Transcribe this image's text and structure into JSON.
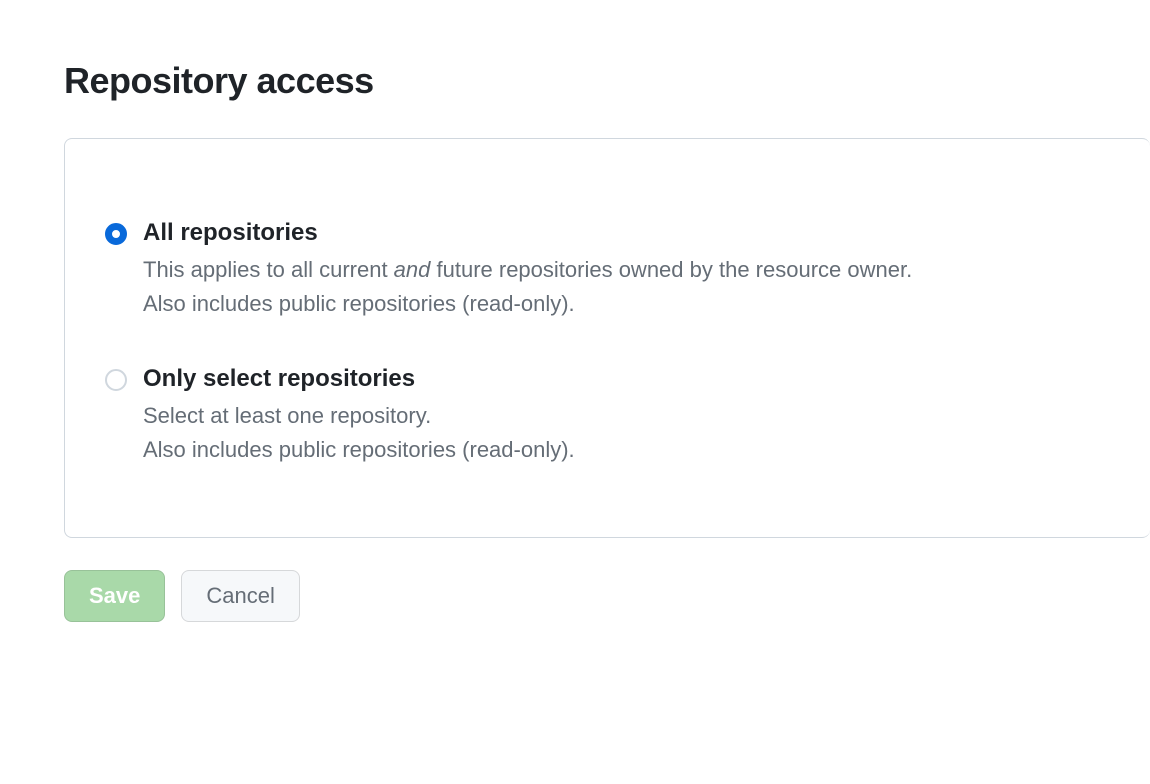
{
  "title": "Repository access",
  "options": [
    {
      "label": "All repositories",
      "desc_pre": "This applies to all current ",
      "desc_em": "and",
      "desc_post": " future repositories owned by the resource owner.",
      "line2": "Also includes public repositories (read-only).",
      "selected": true
    },
    {
      "label": "Only select repositories",
      "desc_plain": "Select at least one repository.",
      "line2": "Also includes public repositories (read-only).",
      "selected": false
    }
  ],
  "buttons": {
    "save": "Save",
    "cancel": "Cancel"
  }
}
